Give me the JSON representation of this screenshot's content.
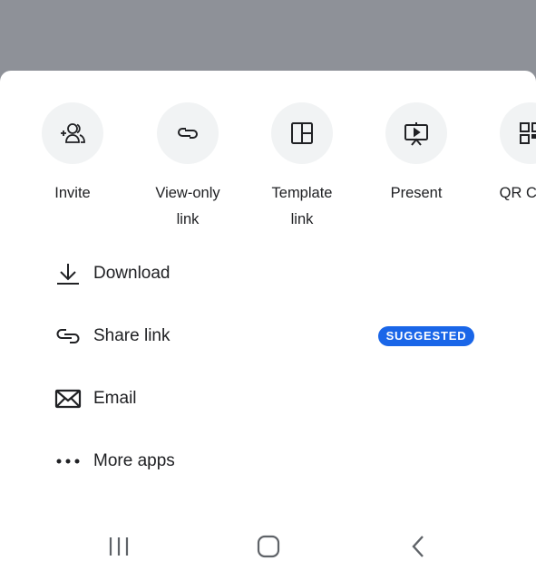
{
  "quick_actions": [
    {
      "label_line1": "Invite",
      "label_line2": "",
      "icon": "add-person-icon"
    },
    {
      "label_line1": "View-only",
      "label_line2": "link",
      "icon": "link-icon"
    },
    {
      "label_line1": "Template",
      "label_line2": "link",
      "icon": "template-icon"
    },
    {
      "label_line1": "Present",
      "label_line2": "",
      "icon": "present-icon"
    },
    {
      "label_line1": "QR Code",
      "label_line2": "",
      "icon": "qr-code-icon"
    }
  ],
  "list": [
    {
      "label": "Download",
      "icon": "download-icon"
    },
    {
      "label": "Share link",
      "icon": "link-icon",
      "badge": "SUGGESTED"
    },
    {
      "label": "Email",
      "icon": "email-icon"
    },
    {
      "label": "More apps",
      "icon": "more-horizontal-icon"
    }
  ],
  "colors": {
    "badge": "#1a66e8",
    "circle": "#f1f3f4",
    "backdrop": "#8e9198"
  },
  "nav": [
    "recent-apps-icon",
    "home-icon",
    "back-icon"
  ]
}
